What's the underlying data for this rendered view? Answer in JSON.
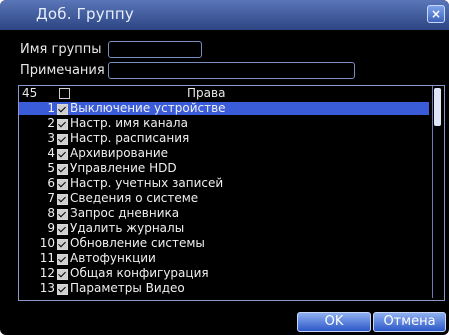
{
  "dialog": {
    "title": "Доб. Группу",
    "close_glyph": "×"
  },
  "form": {
    "group_name_label": "Имя группы",
    "group_name_value": "",
    "notes_label": "Примечания",
    "notes_value": ""
  },
  "list": {
    "count": "45",
    "header_title": "Права",
    "rows": [
      {
        "num": "1",
        "label": "Выключение устройстве",
        "checked": true,
        "selected": true
      },
      {
        "num": "2",
        "label": "Настр. имя канала",
        "checked": true
      },
      {
        "num": "3",
        "label": "Настр. расписания",
        "checked": true
      },
      {
        "num": "4",
        "label": "Архивирование",
        "checked": true
      },
      {
        "num": "5",
        "label": "Управление HDD",
        "checked": true
      },
      {
        "num": "6",
        "label": "Настр. учетных записей",
        "checked": true
      },
      {
        "num": "7",
        "label": "Сведения о системе",
        "checked": true
      },
      {
        "num": "8",
        "label": "Запрос дневника",
        "checked": true
      },
      {
        "num": "9",
        "label": "Удалить журналы",
        "checked": true
      },
      {
        "num": "10",
        "label": "Обновление системы",
        "checked": true
      },
      {
        "num": "11",
        "label": "Автофункции",
        "checked": true
      },
      {
        "num": "12",
        "label": "Общая конфигурация",
        "checked": true
      },
      {
        "num": "13",
        "label": "Параметры Видео",
        "checked": true
      }
    ]
  },
  "buttons": {
    "ok_label": "OK",
    "cancel_label": "Отмена"
  },
  "colors": {
    "selection": "#3a5cd8",
    "titlebar": "#3b5aa0",
    "background": "#000000"
  }
}
